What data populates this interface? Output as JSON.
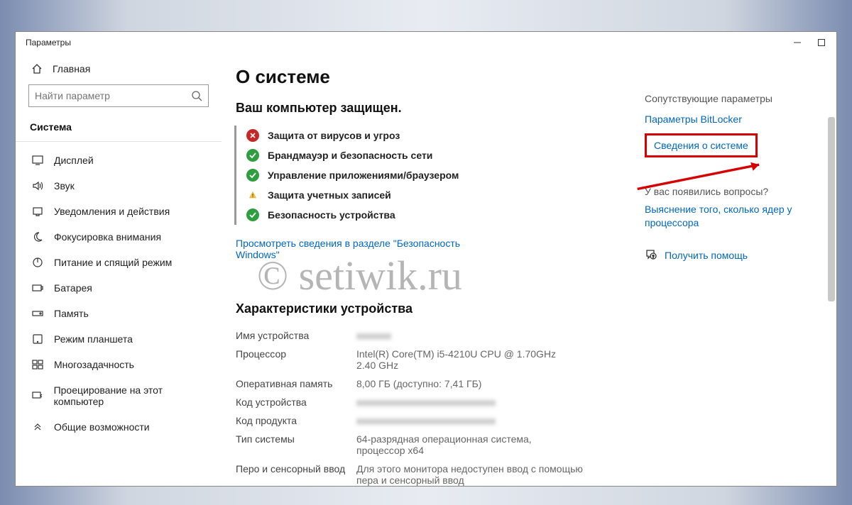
{
  "window": {
    "title": "Параметры"
  },
  "sidebar": {
    "home": "Главная",
    "search_placeholder": "Найти параметр",
    "category": "Система",
    "items": [
      {
        "icon": "display",
        "label": "Дисплей"
      },
      {
        "icon": "sound",
        "label": "Звук"
      },
      {
        "icon": "notifications",
        "label": "Уведомления и действия"
      },
      {
        "icon": "focus",
        "label": "Фокусировка внимания"
      },
      {
        "icon": "power",
        "label": "Питание и спящий режим"
      },
      {
        "icon": "battery",
        "label": "Батарея"
      },
      {
        "icon": "storage",
        "label": "Память"
      },
      {
        "icon": "tablet",
        "label": "Режим планшета"
      },
      {
        "icon": "multitask",
        "label": "Многозадачность"
      },
      {
        "icon": "project",
        "label": "Проецирование на этот компьютер"
      },
      {
        "icon": "shared",
        "label": "Общие возможности"
      }
    ]
  },
  "about": {
    "title": "О системе",
    "protected": "Ваш компьютер защищен.",
    "security": [
      {
        "status": "bad",
        "label": "Защита от вирусов и угроз"
      },
      {
        "status": "ok",
        "label": "Брандмауэр и безопасность сети"
      },
      {
        "status": "ok",
        "label": "Управление приложениями/браузером"
      },
      {
        "status": "warn",
        "label": "Защита учетных записей"
      },
      {
        "status": "ok",
        "label": "Безопасность устройства"
      }
    ],
    "security_link": "Просмотреть сведения в разделе \"Безопасность Windows\"",
    "spec_title": "Характеристики устройства",
    "specs": [
      {
        "k": "Имя устройства",
        "v": "",
        "blur": true
      },
      {
        "k": "Процессор",
        "v": "Intel(R) Core(TM) i5-4210U CPU @ 1.70GHz 2.40 GHz"
      },
      {
        "k": "Оперативная память",
        "v": "8,00 ГБ (доступно: 7,41 ГБ)"
      },
      {
        "k": "Код устройства",
        "v": "",
        "blur": true
      },
      {
        "k": "Код продукта",
        "v": "",
        "blur": true
      },
      {
        "k": "Тип системы",
        "v": "64-разрядная операционная система, процессор x64"
      },
      {
        "k": "Перо и сенсорный ввод",
        "v": "Для этого монитора недоступен ввод с помощью пера и сенсорный ввод"
      }
    ]
  },
  "right": {
    "related_title": "Сопутствующие параметры",
    "bitlocker": "Параметры BitLocker",
    "system_info": "Сведения о системе",
    "questions_title": "У вас появились вопросы?",
    "cores_link": "Выяснение того, сколько ядер у процессора",
    "get_help": "Получить помощь"
  },
  "watermark": "© setiwik.ru"
}
